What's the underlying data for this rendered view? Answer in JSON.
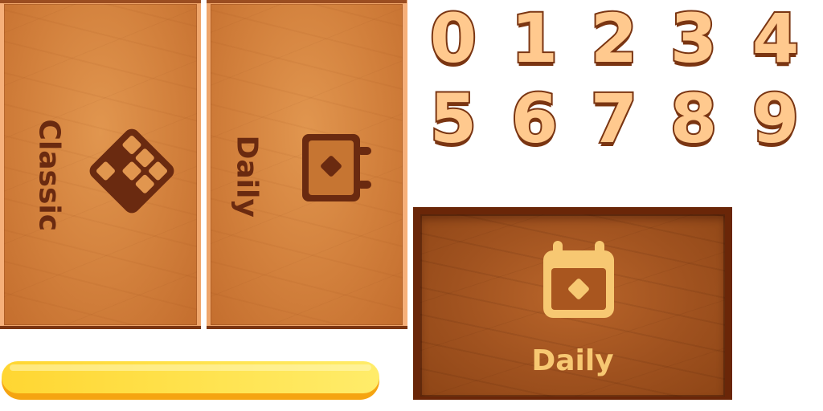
{
  "modes": {
    "classic": {
      "label": "Classic",
      "icon": "block-grid-icon"
    },
    "daily": {
      "label": "Daily",
      "icon": "calendar-icon"
    }
  },
  "digits": [
    "0",
    "1",
    "2",
    "3",
    "4",
    "5",
    "6",
    "7",
    "8",
    "9"
  ],
  "daily_card": {
    "label": "Daily",
    "icon": "calendar-icon"
  },
  "progress": {
    "fraction": 1.0
  },
  "colors": {
    "wood_light": "#d2803c",
    "wood_dark": "#a0521f",
    "label_dark": "#6a2a10",
    "digit_fill": "#ffc98e",
    "digit_outline": "#7a3512",
    "daily_gold": "#f7c872",
    "bar_yellow": "#ffe14a",
    "bar_orange": "#f5a411"
  }
}
